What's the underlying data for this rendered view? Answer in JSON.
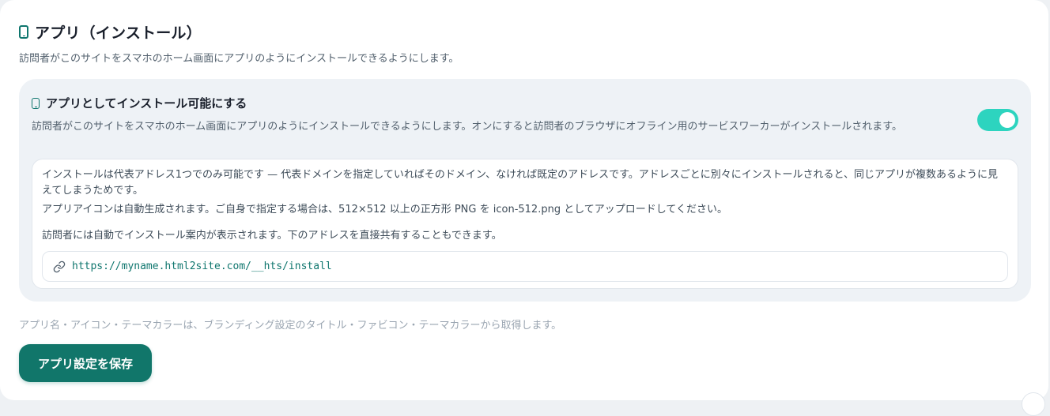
{
  "section": {
    "icon": "phone-icon",
    "title": "アプリ（インストール）",
    "subtitle": "訪問者がこのサイトをスマホのホーム画面にアプリのようにインストールできるようにします。"
  },
  "install_option": {
    "icon": "phone-icon",
    "title": "アプリとしてインストール可能にする",
    "description": "訪問者がこのサイトをスマホのホーム画面にアプリのようにインストールできるようにします。オンにすると訪問者のブラウザにオフライン用のサービスワーカーがインストールされます。",
    "toggle_on": true,
    "toggle_color": "#2dd4bf"
  },
  "info": {
    "paragraph1": "インストールは代表アドレス1つでのみ可能です — 代表ドメインを指定していればそのドメイン、なければ既定のアドレスです。アドレスごとに別々にインストールされると、同じアプリが複数あるように見えてしまうためです。",
    "paragraph2": "アプリアイコンは自動生成されます。ご自身で指定する場合は、512×512 以上の正方形 PNG を icon-512.png としてアップロードしてください。",
    "paragraph3": "訪問者には自動でインストール案内が表示されます。下のアドレスを直接共有することもできます。",
    "install_url_icon": "link-icon",
    "install_url": "https://myname.html2site.com/__hts/install"
  },
  "footnote": "アプリ名・アイコン・テーマカラーは、ブランディング設定のタイトル・ファビコン・テーマカラーから取得します。",
  "save_button": {
    "label": "アプリ設定を保存",
    "color": "#11766a"
  }
}
